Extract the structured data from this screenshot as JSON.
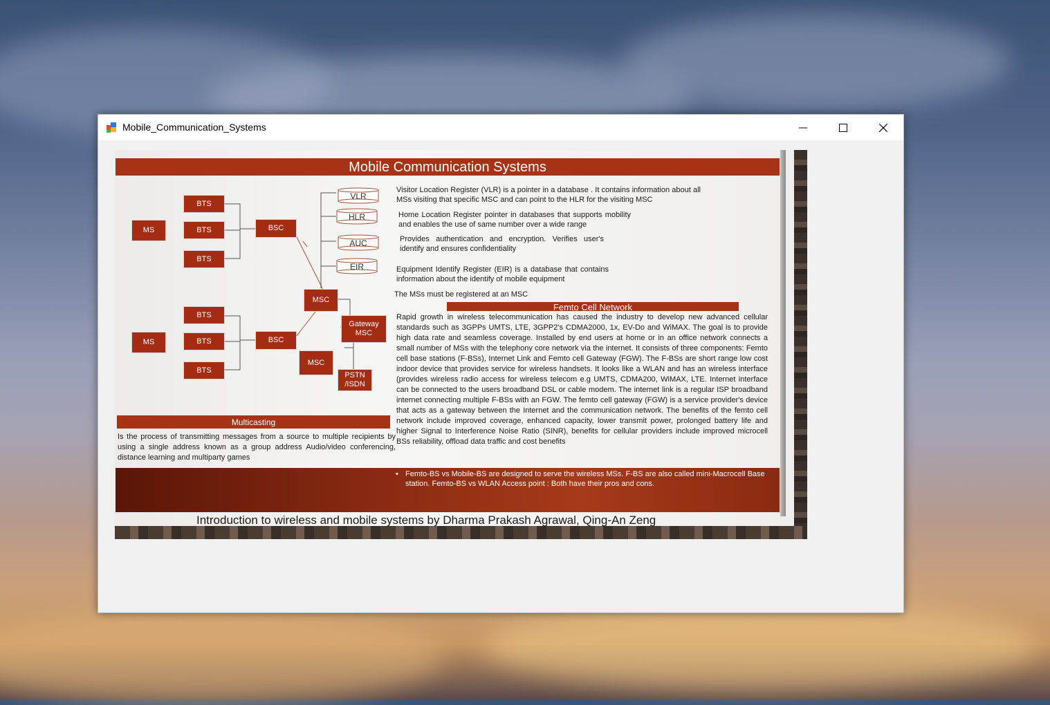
{
  "window": {
    "title": "Mobile_Communication_Systems",
    "icons": {
      "app": "app-icon",
      "minimize": "minimize-icon",
      "maximize": "maximize-icon",
      "close": "close-icon"
    }
  },
  "slide": {
    "title": "Mobile Communication Systems",
    "diagram": {
      "ms_top": "MS",
      "ms_bottom": "MS",
      "bts": [
        "BTS",
        "BTS",
        "BTS",
        "BTS",
        "BTS",
        "BTS"
      ],
      "bsc_top": "BSC",
      "bsc_bottom": "BSC",
      "msc_main": "MSC",
      "msc_second": "MSC",
      "gateway_msc": "Gateway MSC",
      "pstn": "PSTN /ISDN",
      "databases": [
        "VLR",
        "HLR",
        "AUC",
        "EIR"
      ]
    },
    "descriptions": {
      "vlr": "Visitor Location Register (VLR) is a pointer in a database . It contains information about all MSs visiting that specific MSC and can point to the HLR for the visiting MSC",
      "hlr": "Home Location Register pointer in databases that supports mobility and enables the use of same number over a wide range",
      "auc": "Provides authentication and encryption. Verifies user's identify and ensures confidentiality",
      "eir": "Equipment Identify Register (EIR) is a database that contains information about the identify of mobile equipment",
      "msc_note": "The MSs must be registered at an MSC"
    },
    "femto": {
      "heading": "Femto Cell Network",
      "body": "Rapid growth in wireless telecommunication has caused the industry to develop new advanced cellular standards such as 3GPPs UMTS, LTE, 3GPP2's CDMA2000, 1x, EV-Do and WiMAX. The goal is to provide high data rate and seamless coverage. Installed by end users at home or in an office network connects a small number of MSs with the telephony core network via the internet. It consists of three components: Femto cell base stations (F-BSs), Internet Link and Femto cell Gateway (FGW). The F-BSs are short range low cost indoor device that provides service for wireless handsets. It looks like a WLAN and has an wireless interface (provides wireless radio access for wireless telecom e.g UMTS, CDMA200, WiMAX, LTE. Internet interface can be connected to the users broadband DSL or cable modem. The internet link is a regular ISP broadband internet connecting multiple F-BSs with an FGW. The femto cell gateway (FGW) is a service provider's device that acts as a gateway between the Internet and the communication network. The benefits of the femto cell network include improved coverage, enhanced capacity, lower transmit power, prolonged battery life and higher Signal to Interference Noise Ratio (SINR), benefits for cellular providers include improved microcell BSs reliability, offload data traffic and cost benefits",
      "bullet": "Femto-BS vs Mobile-BS are designed to serve the wireless MSs. F-BS are also called mini-Macrocell Base station. Femto-BS vs WLAN Access point : Both have their pros and cons."
    },
    "multicasting": {
      "heading": "Multicasting",
      "body": "Is the process of transmitting messages from a source to multiple recipients by using a single address known as a group address Audio/video conferencing, distance learning and multiparty games"
    },
    "footer": "Introduction to wireless and mobile systems by Dharma Prakash Agrawal, Qing-An Zeng"
  },
  "colors": {
    "accent": "#a83216",
    "titlebar": "#ffffff",
    "client": "#f0f0f0"
  }
}
